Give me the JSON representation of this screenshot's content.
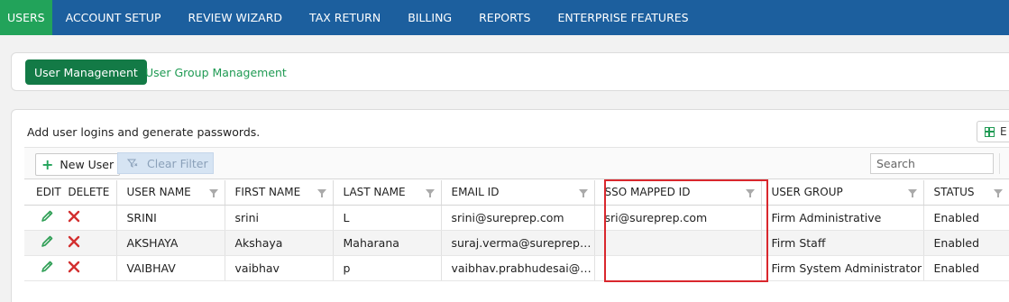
{
  "topnav": {
    "items": [
      "USERS",
      "ACCOUNT SETUP",
      "REVIEW WIZARD",
      "TAX RETURN",
      "BILLING",
      "REPORTS",
      "ENTERPRISE FEATURES"
    ],
    "active_index": 0
  },
  "subtabs": {
    "active_label": "User Management",
    "other_label": "User Group Management"
  },
  "description": "Add user logins and generate passwords.",
  "export": {
    "label": "E"
  },
  "toolbar": {
    "new_user_label": "New User",
    "clear_filter_label": "Clear Filter",
    "search_placeholder": "Search"
  },
  "table": {
    "headers": {
      "edit": "EDIT",
      "delete": "DELETE",
      "username": "USER NAME",
      "firstname": "FIRST NAME",
      "lastname": "LAST NAME",
      "email": "EMAIL ID",
      "sso": "SSO MAPPED ID",
      "group": "USER GROUP",
      "status": "STATUS"
    },
    "rows": [
      {
        "username": "SRINI",
        "firstname": "srini",
        "lastname": "L",
        "email": "srini@sureprep.com",
        "sso": "sri@sureprep.com",
        "group": "Firm Administrative",
        "status": "Enabled"
      },
      {
        "username": "AKSHAYA",
        "firstname": "Akshaya",
        "lastname": "Maharana",
        "email": "suraj.verma@sureprep.com",
        "sso": "",
        "group": "Firm Staff",
        "status": "Enabled"
      },
      {
        "username": "VAIBHAV",
        "firstname": "vaibhav",
        "lastname": "p",
        "email": "vaibhav.prabhudesai@sure…",
        "sso": "",
        "group": "Firm System Administrator",
        "status": "Enabled"
      }
    ]
  },
  "colors": {
    "nav_bg": "#1c5f9e",
    "active_tab": "#22a35a",
    "primary_button": "#137a46",
    "link": "#1f9a53",
    "delete_icon": "#d32f2f",
    "highlight_border": "#d9272d"
  },
  "icons": [
    "edit-pencil-icon",
    "delete-x-icon",
    "plus-icon",
    "clear-filter-icon",
    "excel-icon",
    "column-filter-icon"
  ]
}
